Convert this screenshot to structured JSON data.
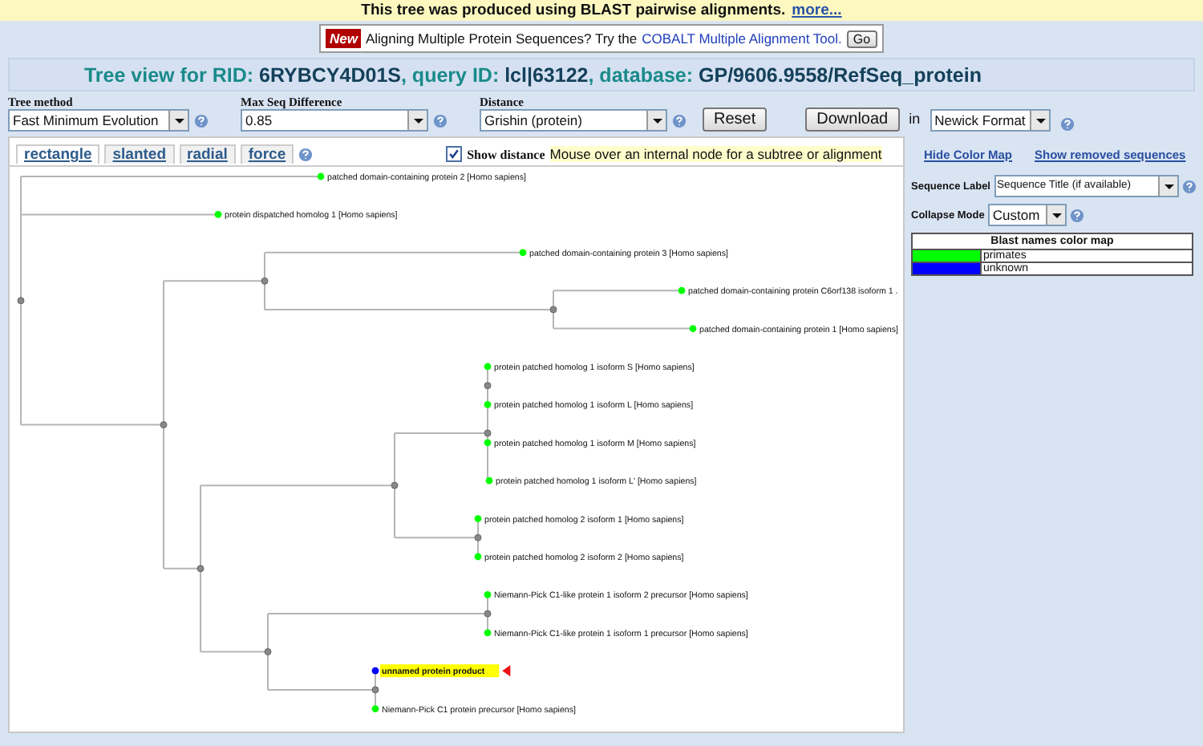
{
  "banner": {
    "text": "This tree was produced using BLAST pairwise alignments.",
    "link": "more..."
  },
  "promo": {
    "badge": "New",
    "text": "Aligning Multiple Protein Sequences? Try the",
    "link": "COBALT Multiple Alignment Tool.",
    "button": "Go"
  },
  "title": [
    {
      "kind": "label",
      "text": "Tree view for RID: "
    },
    {
      "kind": "value",
      "text": "6RYBCY4D01S"
    },
    {
      "kind": "label",
      "text": ", query ID: "
    },
    {
      "kind": "value",
      "text": "lcl|63122"
    },
    {
      "kind": "label",
      "text": ", database: "
    },
    {
      "kind": "value",
      "text": "GP/9606.9558/RefSeq_protein"
    }
  ],
  "controls": {
    "tree_method": {
      "label": "Tree method",
      "value": "Fast Minimum Evolution"
    },
    "max_seq_difference": {
      "label": "Max Seq Difference",
      "value": "0.85"
    },
    "distance": {
      "label": "Distance",
      "value": "Grishin (protein)"
    },
    "reset": "Reset",
    "download": "Download",
    "in": "in",
    "format": "Newick Format"
  },
  "view_tabs": [
    {
      "label": "rectangle",
      "selected": true
    },
    {
      "label": "slanted",
      "selected": false
    },
    {
      "label": "radial",
      "selected": false
    },
    {
      "label": "force",
      "selected": false
    }
  ],
  "show_distance": {
    "label": "Show distance",
    "checked": true
  },
  "hint": "Mouse over an internal node for a subtree or alignment",
  "tree": {
    "children": [
      {
        "label": "patched domain-containing protein 2 [Homo sapiens]",
        "color": "#00ff00",
        "query": false
      },
      {
        "label": "protein dispatched homolog 1 [Homo sapiens]",
        "color": "#00ff00",
        "query": false
      },
      {
        "children": [
          {
            "children": [
              {
                "label": "patched domain-containing protein 3 [Homo sapiens]",
                "color": "#00ff00",
                "query": false
              },
              {
                "children": [
                  {
                    "label": "patched domain-containing protein C6orf138 isoform 1 .",
                    "color": "#00ff00",
                    "query": false
                  },
                  {
                    "label": "patched domain-containing protein 1 [Homo sapiens]",
                    "color": "#00ff00",
                    "query": false
                  }
                ]
              }
            ]
          },
          {
            "children": [
              {
                "children": [
                  {
                    "children": [
                      {
                        "children": [
                          {
                            "label": "protein patched homolog 1 isoform S [Homo sapiens]",
                            "color": "#00ff00",
                            "query": false
                          },
                          {
                            "label": "protein patched homolog 1 isoform L [Homo sapiens]",
                            "color": "#00ff00",
                            "query": false
                          }
                        ]
                      },
                      {
                        "label": "protein patched homolog 1 isoform M [Homo sapiens]",
                        "color": "#00ff00",
                        "query": false
                      },
                      {
                        "label": "protein patched homolog 1 isoform L' [Homo sapiens]",
                        "color": "#00ff00",
                        "query": false
                      }
                    ]
                  },
                  {
                    "children": [
                      {
                        "label": "protein patched homolog 2 isoform 1 [Homo sapiens]",
                        "color": "#00ff00",
                        "query": false
                      },
                      {
                        "label": "protein patched homolog 2 isoform 2 [Homo sapiens]",
                        "color": "#00ff00",
                        "query": false
                      }
                    ]
                  }
                ]
              },
              {
                "children": [
                  {
                    "children": [
                      {
                        "label": "Niemann-Pick C1-like protein 1 isoform 2 precursor [Homo sapiens]",
                        "color": "#00ff00",
                        "query": false
                      },
                      {
                        "label": "Niemann-Pick C1-like protein 1 isoform 1 precursor [Homo sapiens]",
                        "color": "#00ff00",
                        "query": false
                      }
                    ]
                  },
                  {
                    "children": [
                      {
                        "label": "unnamed protein product",
                        "color": "#0000ff",
                        "query": true
                      },
                      {
                        "label": "Niemann-Pick C1 protein precursor [Homo sapiens]",
                        "color": "#00ff00",
                        "query": false
                      }
                    ]
                  }
                ]
              }
            ]
          }
        ]
      }
    ]
  },
  "side_links": [
    "Hide Color Map",
    "Show removed sequences"
  ],
  "sequence_label": {
    "label": "Sequence Label",
    "value": "Sequence Title (if available)"
  },
  "collapse_mode": {
    "label": "Collapse Mode",
    "value": "Custom"
  },
  "color_map": {
    "title": "Blast names color map",
    "entries": [
      {
        "name": "primates",
        "color": "#00ff00"
      },
      {
        "name": "unknown",
        "color": "#0000ff"
      }
    ]
  }
}
